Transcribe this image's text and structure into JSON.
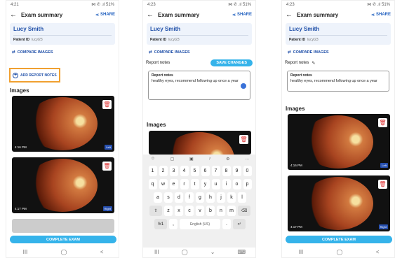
{
  "status": {
    "time1": "4:21",
    "time2": "4:23",
    "time3": "4:23",
    "right": "⋈ ✆ .ıl 51%"
  },
  "header": {
    "title": "Exam summary",
    "share": "SHARE"
  },
  "patient": {
    "name": "Lucy Smith",
    "id_label": "Patient ID",
    "id_value": "lucyl23"
  },
  "actions": {
    "compare": "COMPARE IMAGES",
    "add_notes": "ADD REPORT NOTES",
    "save_changes": "SAVE CHANGES",
    "complete": "COMPLETE EXAM"
  },
  "notes": {
    "section": "Report notes",
    "field_label": "Report notes",
    "text": "healthy eyes, recommend following up once a year"
  },
  "images_section": "Images",
  "images": [
    {
      "time": "4:16 PM",
      "eye": "Left"
    },
    {
      "time": "4:17 PM",
      "eye": "Right"
    }
  ],
  "keyboard": {
    "numbers": [
      "1",
      "2",
      "3",
      "4",
      "5",
      "6",
      "7",
      "8",
      "9",
      "0"
    ],
    "row1": [
      "q",
      "w",
      "e",
      "r",
      "t",
      "y",
      "u",
      "i",
      "o",
      "p"
    ],
    "row2": [
      "a",
      "s",
      "d",
      "f",
      "g",
      "h",
      "j",
      "k",
      "l"
    ],
    "row3": [
      "z",
      "x",
      "c",
      "v",
      "b",
      "n",
      "m"
    ],
    "symbols": "!#1",
    "comma": ",",
    "space": "English (US)",
    "period": "."
  },
  "nav": {
    "recent": "III",
    "home": "◯",
    "back": "<"
  }
}
